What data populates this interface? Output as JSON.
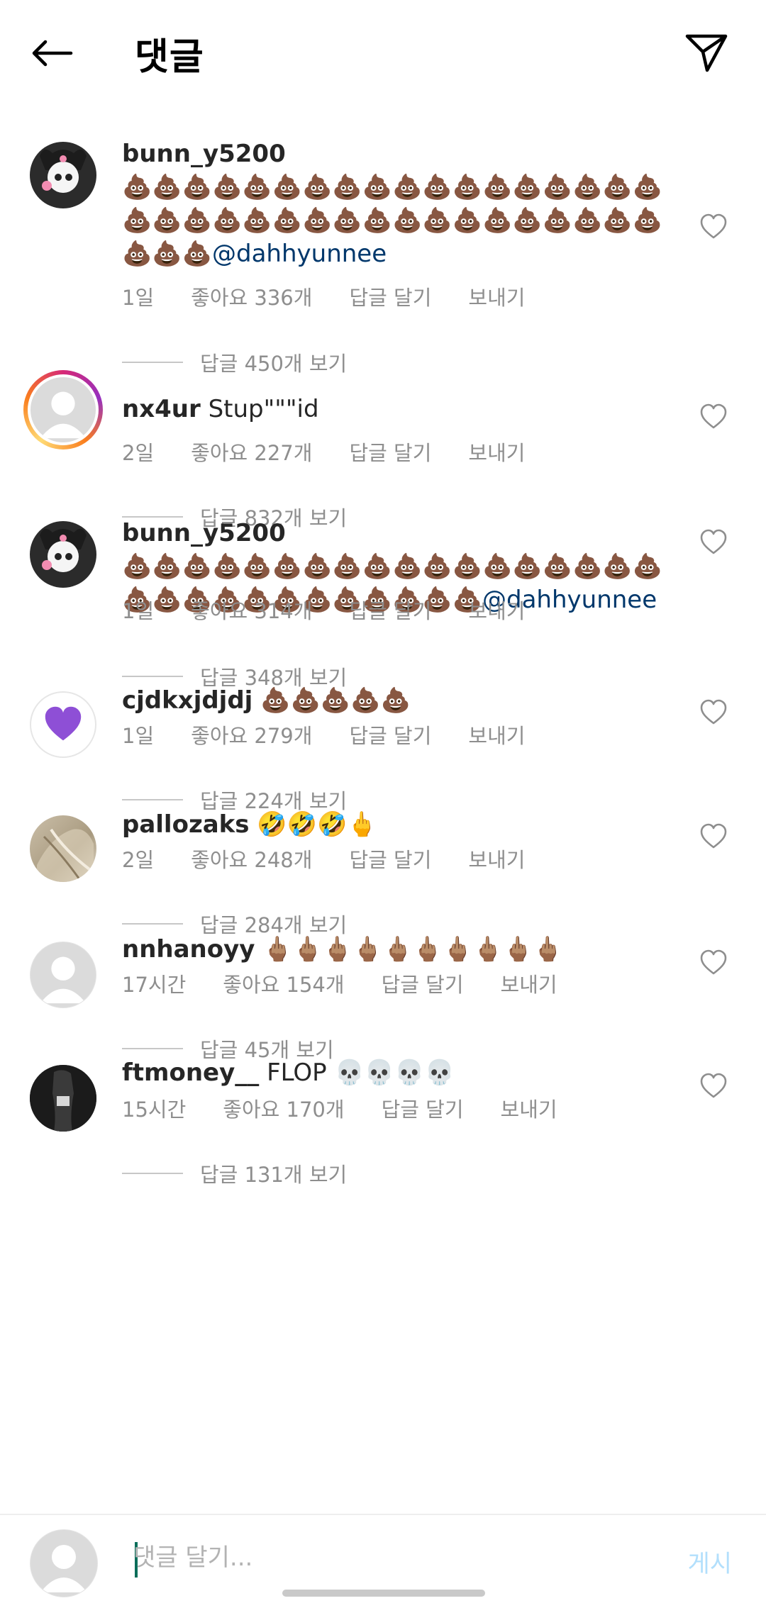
{
  "header": {
    "title": "댓글",
    "back_icon": "arrow-left-icon",
    "send_icon": "paper-plane-icon"
  },
  "comments": [
    {
      "username": "bunn_y5200",
      "text": "💩💩💩💩💩💩💩💩💩💩💩💩💩💩💩💩💩💩💩💩💩💩💩💩💩💩💩💩💩💩💩💩💩💩💩💩💩💩💩",
      "mention": "@dahhyunnee",
      "time": "1일",
      "likes": "좋아요 336개",
      "reply_label": "답글 달기",
      "send_label": "보내기",
      "view_replies": "답글 450개 보기"
    },
    {
      "username": "nx4ur",
      "text": "Stup\"\"\"id",
      "mention": "",
      "time": "2일",
      "likes": "좋아요 227개",
      "reply_label": "답글 달기",
      "send_label": "보내기",
      "view_replies": "답글 832개 보기"
    },
    {
      "username": "bunn_y5200",
      "text": "💩💩💩💩💩💩💩💩💩💩💩💩💩💩💩💩💩💩💩💩💩💩💩💩💩💩💩💩💩💩",
      "mention": "@dahhyunnee",
      "time": "1일",
      "likes": "좋아요 314개",
      "reply_label": "답글 달기",
      "send_label": "보내기",
      "view_replies": "답글 348개 보기"
    },
    {
      "username": "cjdkxjdjdj",
      "text": "💩💩💩💩💩",
      "mention": "",
      "time": "1일",
      "likes": "좋아요 279개",
      "reply_label": "답글 달기",
      "send_label": "보내기",
      "view_replies": "답글 224개 보기"
    },
    {
      "username": "pallozaks",
      "text": "🤣🤣🤣🖕",
      "mention": "",
      "time": "2일",
      "likes": "좋아요 248개",
      "reply_label": "답글 달기",
      "send_label": "보내기",
      "view_replies": "답글 284개 보기"
    },
    {
      "username": "nnhanoyy",
      "text": "🖕🏽🖕🏽🖕🏽🖕🏽🖕🏽🖕🏽🖕🏽🖕🏽🖕🏽🖕🏽",
      "mention": "",
      "time": "17시간",
      "likes": "좋아요 154개",
      "reply_label": "답글 달기",
      "send_label": "보내기",
      "view_replies": "답글 45개 보기"
    },
    {
      "username": "ftmoney__",
      "text": "FLOP 💀💀💀💀",
      "mention": "",
      "time": "15시간",
      "likes": "좋아요 170개",
      "reply_label": "답글 달기",
      "send_label": "보내기",
      "view_replies": "답글 131개 보기"
    }
  ],
  "composer": {
    "placeholder": "댓글 달기...",
    "post_label": "게시"
  },
  "colors": {
    "mention": "#00376b",
    "meta": "#8e8e8e",
    "post_disabled": "#b2dffc"
  }
}
